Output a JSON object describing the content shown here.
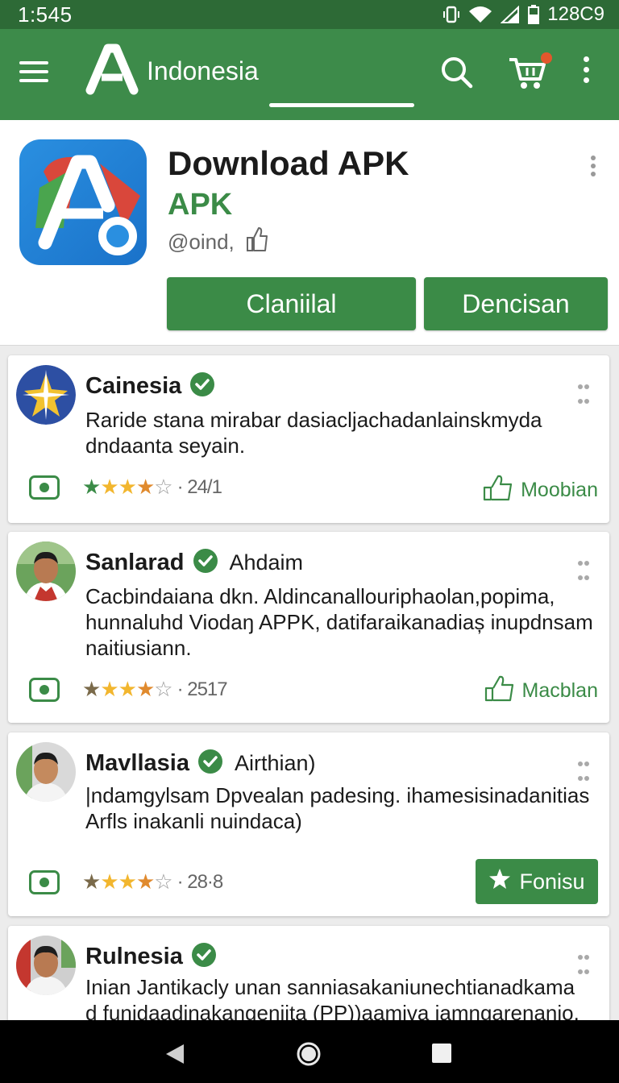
{
  "status_bar": {
    "time": "1:545",
    "right_text": "128C9",
    "icons": [
      "vibrate-icon",
      "wifi-icon",
      "signal-icon",
      "battery-icon"
    ]
  },
  "app_bar": {
    "title": "Indonesia",
    "icons": [
      "menu-icon",
      "logo-icon",
      "search-icon",
      "cart-icon",
      "more-vert-icon"
    ]
  },
  "header": {
    "title": "Download APK",
    "subtitle": "APK",
    "handle": "@oind,",
    "button_primary": "Claniilal",
    "button_secondary": "Dencisan"
  },
  "reviews": [
    {
      "name": "Cainesia",
      "extra": "",
      "verified": true,
      "text_line1": "Raride stana mirabar dasiacljachadanlainskmyda",
      "text_line2": "dndaanta seyain.",
      "text_line3": "",
      "rating_label": "· 24/1",
      "action_label": "Moobian",
      "action_style": "link"
    },
    {
      "name": "Sanlarad",
      "extra": "Ahdaim",
      "verified": true,
      "text_line1": "Cacbindaiana dkn. Aldincanallouriphaolan,popima,",
      "text_line2": "hunnaluhd Viodaŋ APPK, datifaraikanadiaș inupdnsam",
      "text_line3": "naitiusiann.",
      "rating_label": "· 2517",
      "action_label": "Macblan",
      "action_style": "link"
    },
    {
      "name": "Mavllasia",
      "extra": "Airthian)",
      "verified": true,
      "text_line1": "|ndamgylsam Dpvealan padesing. ihamesisinadanitias",
      "text_line2": "Arfls inakanli nuindaca)",
      "text_line3": "",
      "rating_label": "· 28·8",
      "action_label": "Fonisu",
      "action_style": "button"
    },
    {
      "name": "Rulnesia",
      "extra": "",
      "verified": true,
      "text_line1": "Inian Jantikacly unan sanniasakaniunechtianadkama",
      "text_line2": "d funidaadinakangeniita (PP))aamiva iamngarenanio.",
      "text_line3": "",
      "rating_label": "",
      "action_label": "",
      "action_style": "none"
    }
  ],
  "colors": {
    "status_bar": "#2d6a36",
    "app_bar": "#3d8b4a",
    "accent": "#3b8b47",
    "star": "#f2b62e"
  },
  "nav_bar": {
    "icons": [
      "back-icon",
      "home-icon",
      "recents-icon"
    ]
  }
}
